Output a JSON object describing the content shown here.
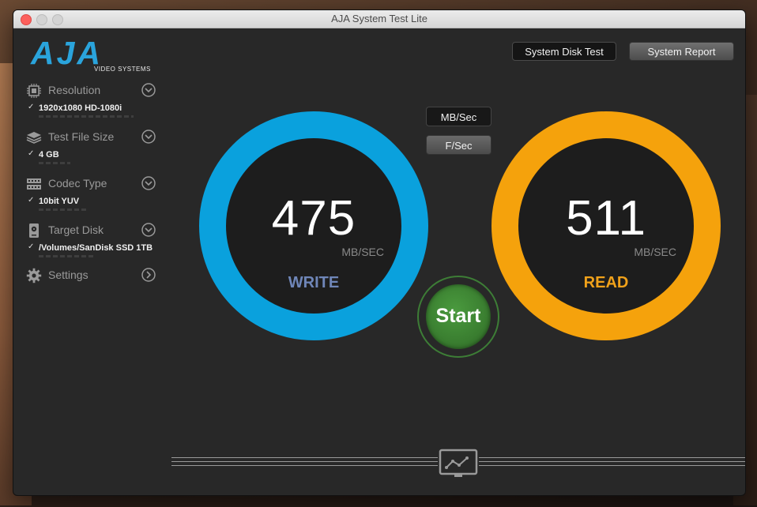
{
  "window": {
    "title": "AJA System Test Lite"
  },
  "logo": {
    "brand": "AJA",
    "subtitle": "VIDEO SYSTEMS"
  },
  "buttons": {
    "disk_test": "System Disk Test",
    "system_report": "System Report",
    "start": "Start"
  },
  "units": {
    "mb": "MB/Sec",
    "frames": "F/Sec"
  },
  "sidebar": {
    "items": [
      {
        "label": "Resolution",
        "icon": "chip-icon",
        "value": "1920x1080 HD-1080i"
      },
      {
        "label": "Test File Size",
        "icon": "stack-icon",
        "value": "4 GB"
      },
      {
        "label": "Codec Type",
        "icon": "film-icon",
        "value": "10bit YUV"
      },
      {
        "label": "Target Disk",
        "icon": "disk-icon",
        "value": "/Volumes/SanDisk SSD 1TB"
      },
      {
        "label": "Settings",
        "icon": "gear-icon"
      }
    ]
  },
  "write": {
    "value": "475",
    "unit": "MB/SEC",
    "label": "WRITE",
    "color": "#0aa1dd",
    "label_color": "#6f86b8"
  },
  "read": {
    "value": "511",
    "unit": "MB/SEC",
    "label": "READ",
    "color": "#f5a20c",
    "label_color": "#f0a11a"
  },
  "colors": {
    "start_green": "#3a7e30"
  }
}
